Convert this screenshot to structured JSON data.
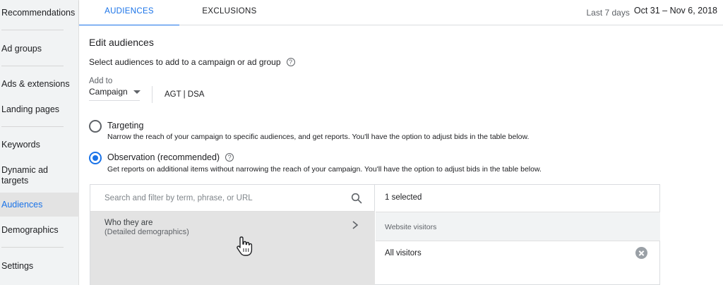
{
  "sidebar": {
    "items": [
      {
        "label": "Recommendations"
      },
      {
        "label": "Ad groups"
      },
      {
        "label": "Ads & extensions"
      },
      {
        "label": "Landing pages"
      },
      {
        "label": "Keywords"
      },
      {
        "label": "Dynamic ad targets"
      },
      {
        "label": "Audiences",
        "active": true
      },
      {
        "label": "Demographics"
      },
      {
        "label": "Settings"
      }
    ]
  },
  "tabs": [
    {
      "label": "AUDIENCES",
      "active": true
    },
    {
      "label": "EXCLUSIONS",
      "active": false
    }
  ],
  "date_range": {
    "label": "Last 7 days",
    "value": "Oct 31 – Nov 6, 2018"
  },
  "editor": {
    "title": "Edit audiences",
    "subtitle": "Select audiences to add to a campaign or ad group",
    "help_glyph": "?",
    "add_to_label": "Add to",
    "add_to_value": "Campaign",
    "campaign_name": "AGT | DSA"
  },
  "options": [
    {
      "title": "Targeting",
      "description": "Narrow the reach of your campaign to specific audiences, and get reports. You'll have the option to adjust bids in the table below.",
      "checked": false
    },
    {
      "title": "Observation (recommended)",
      "description": "Get reports on additional items without narrowing the reach of your campaign. You'll have the option to adjust bids in the table below.",
      "checked": true
    }
  ],
  "picker": {
    "search_placeholder": "Search and filter by term, phrase, or URL",
    "category_title": "Who they are",
    "category_sub": "(Detailed demographics)",
    "selected_count": "1 selected",
    "group_label": "Website visitors",
    "selected_item": "All visitors"
  },
  "colors": {
    "accent": "#1a73e8",
    "sidebar_bg": "#f1f3f4",
    "active_row_bg": "#e3e3e3"
  }
}
